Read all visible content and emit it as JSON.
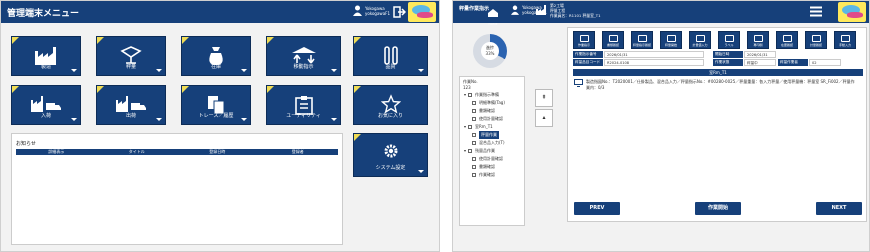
{
  "left": {
    "title": "管理端末メニュー",
    "user": {
      "line1": "Yokogawa",
      "line2": "yokogawaF1"
    },
    "tiles": [
      {
        "label": "製造",
        "icon": "factory-icon"
      },
      {
        "label": "秤量",
        "icon": "scale-icon"
      },
      {
        "label": "在庫",
        "icon": "bag-icon"
      },
      {
        "label": "移動指示",
        "icon": "transfer-icon"
      },
      {
        "label": "品質",
        "icon": "test-tubes-icon"
      },
      {
        "label": "入荷",
        "icon": "factory-truck-in-icon"
      },
      {
        "label": "出荷",
        "icon": "factory-truck-out-icon"
      },
      {
        "label": "トレース／履歴",
        "icon": "documents-icon"
      },
      {
        "label": "ユーティリティ",
        "icon": "clipboard-icon"
      },
      {
        "label": "お気に入り",
        "icon": "star-icon"
      },
      {
        "label": "システム設定",
        "icon": "gear-icon"
      }
    ],
    "notice": {
      "title": "お知らせ",
      "columns": [
        "詳細表示",
        "タイトル",
        "登録日時",
        "登録者"
      ]
    }
  },
  "right": {
    "title": "秤量作業指示",
    "home_label": "HOME",
    "site": {
      "plant": "第2工場",
      "line": "秤量工程",
      "status": "作業員名：R1101 秤量室_T1"
    },
    "user": {
      "line1": "Yokogawa",
      "line2": "yokogawaF1"
    },
    "gauge": {
      "label": "進捗",
      "value": "33%",
      "percent": 33
    },
    "tree": {
      "header1": "作業No.",
      "header2": "123",
      "nodes": [
        {
          "label": "作業指示準備",
          "level": 0,
          "expanded": true
        },
        {
          "label": "明細準備(Tag)",
          "level": 1
        },
        {
          "label": "書類確認",
          "level": 1
        },
        {
          "label": "使用計量確認",
          "level": 1
        },
        {
          "label": "室Rm_T1",
          "level": 0,
          "expanded": true
        },
        {
          "label": "秤量作業",
          "level": 1,
          "selected": true
        },
        {
          "label": "混合品入力(T)",
          "level": 1
        },
        {
          "label": "残量品作業",
          "level": 0,
          "expanded": true
        },
        {
          "label": "使用計量確認",
          "level": 1
        },
        {
          "label": "書類確認",
          "level": 1
        },
        {
          "label": "作業確認",
          "level": 1
        }
      ]
    },
    "actions": [
      "作業指示",
      "書類確認",
      "秤量指示確認",
      "秤量開始",
      "計量値入力",
      "ラベル",
      "再印刷",
      "在庫確認",
      "計量確認",
      "手動入力"
    ],
    "info": [
      {
        "label": "作業指示番号",
        "value": "2026/01/31"
      },
      {
        "label": "秤量品目コード",
        "value": "R2024-0108"
      },
      {
        "label": "開始日時",
        "value": "2026/01/31"
      },
      {
        "label": "作業状態",
        "value": "秤量中"
      },
      {
        "label": "秤量作業者",
        "value": "02"
      }
    ],
    "tab_label": "室Rm_T1",
    "message": "製造指図No.：T2020001／仕掛製品、混合品入力／秤量指示No.：#00280-0025／秤量重量：各入力秤量／使用秤量機：秤量室 SR_Fi002／秤量作業内：0/3",
    "buttons": {
      "prev": "PREV",
      "start": "作業開始",
      "next": "NEXT"
    }
  }
}
